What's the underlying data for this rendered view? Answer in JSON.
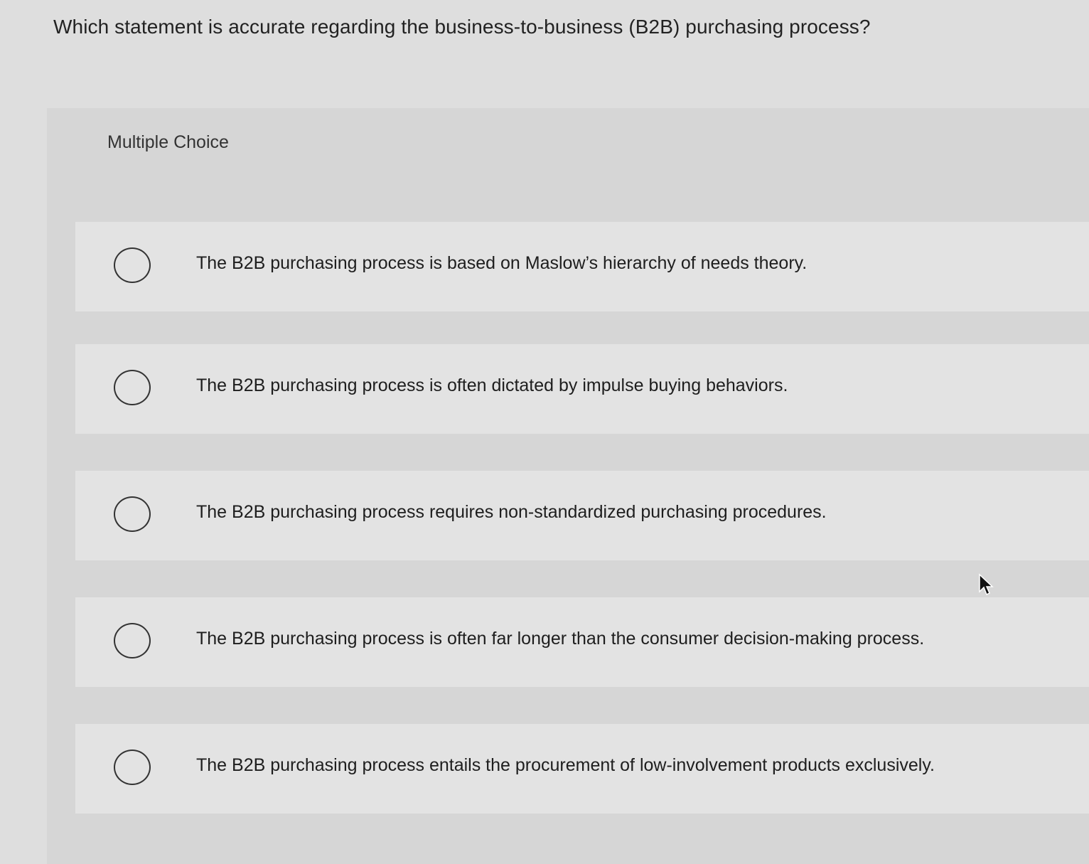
{
  "question": {
    "text": "Which statement is accurate regarding the business-to-business (B2B) purchasing process?"
  },
  "multiple_choice": {
    "title": "Multiple Choice",
    "options": [
      {
        "label": "The B2B purchasing process is based on Maslow’s hierarchy of needs theory.",
        "selected": false
      },
      {
        "label": "The B2B purchasing process is often dictated by impulse buying behaviors.",
        "selected": false
      },
      {
        "label": "The B2B purchasing process requires non-standardized purchasing procedures.",
        "selected": false
      },
      {
        "label": "The B2B purchasing process is often far longer than the consumer decision-making process.",
        "selected": false
      },
      {
        "label": "The B2B purchasing process entails the procurement of low-involvement products exclusively.",
        "selected": false
      }
    ]
  },
  "icons": {
    "radio": "radio-button-unchecked-icon",
    "cursor": "mouse-pointer-icon"
  },
  "colors": {
    "background": "#dedede",
    "panel": "#d6d6d6",
    "option_row": "#e3e3e3",
    "text": "#222222"
  }
}
